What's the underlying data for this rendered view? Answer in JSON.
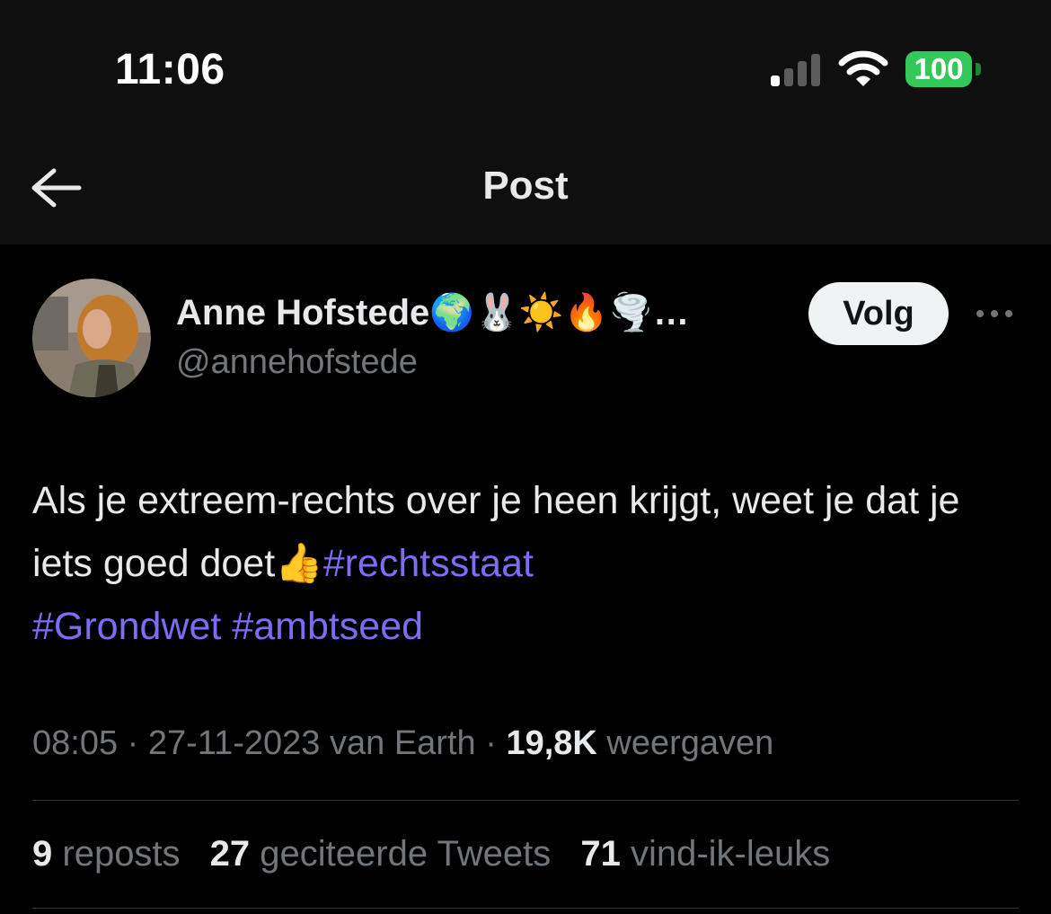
{
  "status_bar": {
    "time": "11:06",
    "battery_level": "100",
    "battery_color": "#34c759"
  },
  "header": {
    "title": "Post",
    "back_icon": "arrow-left-icon"
  },
  "post": {
    "author": {
      "display_name": "Anne Hofstede🌍🐰☀️🔥🌪️…",
      "handle": "@annehofstede"
    },
    "follow_label": "Volg",
    "more_icon": "more-horizontal-icon",
    "text_plain": "Als je extreem-rechts over je heen krijgt, weet je dat je iets goed doet👍",
    "hashtags": [
      "#rechtsstaat",
      "#Grondwet",
      "#ambtseed"
    ],
    "hashtag_color": "#7d6cf5",
    "meta": {
      "time": "08:05",
      "date": "27-11-2023",
      "source": "van Earth",
      "views_count": "19,8K",
      "views_label": "weergaven"
    },
    "stats": {
      "reposts_count": "9",
      "reposts_label": "reposts",
      "quotes_count": "27",
      "quotes_label": "geciteerde Tweets",
      "likes_count": "71",
      "likes_label": "vind-ik-leuks"
    }
  }
}
